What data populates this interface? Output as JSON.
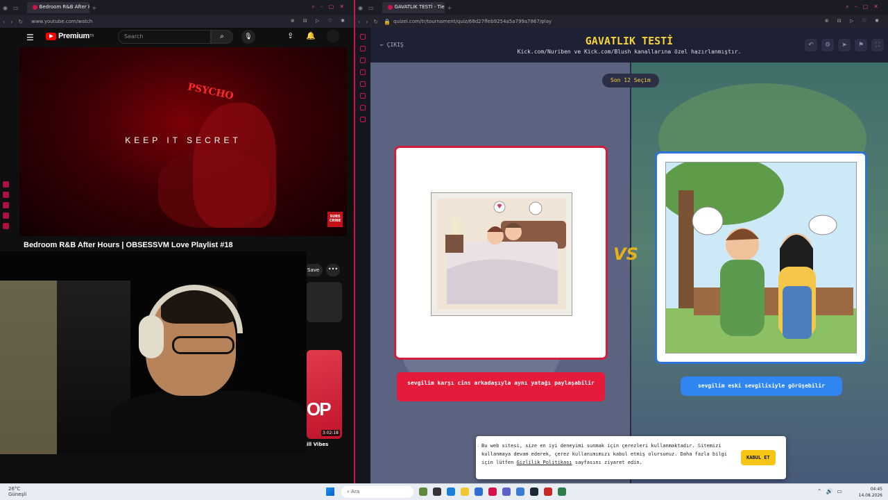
{
  "left_browser": {
    "tab_title": "Bedroom R&B After Hou",
    "url": "www.youtube.com/watch",
    "youtube": {
      "brand": "Premium",
      "region": "TR",
      "search_placeholder": "Search",
      "video_text_keep": "KEEP IT SECRET",
      "video_text_psycho": "PSYCHO",
      "subscribe_badge": "SUBS CRIBE",
      "video_title": "Bedroom R&B After Hours | OBSESSVM Love Playlist #18",
      "save_label": "Save",
      "more_label": "•••",
      "related_thumb_text": "OP",
      "related_duration": "3:02:18",
      "related_title": "ill Vibes"
    }
  },
  "right_browser": {
    "tab_title": "GAVATLIK TESTİ - Tier List",
    "url": "quizei.com/tr/tournament/quiz/68d27ffeb9254a5a799a7867/play",
    "header": {
      "back_label": "ÇIKIŞ",
      "title": "GAVATLIK TESTİ",
      "subtitle": "Kick.com/Nuriben ve Kick.com/Blush kanallarına özel hazırlanmıştır."
    },
    "round_badge": "Son 12 Seçim",
    "vs_label": "VS",
    "option_left": "sevgilim karşı cins arkadaşıyla aynı yatağı paylaşabilir",
    "option_right": "sevgilim eski sevgilisiyle görüşebilir",
    "cookie": {
      "text_1": "Bu web sitesi, size en iyi deneyimi sunmak için çerezleri kullanmaktadır. Sitemizi kullanmaya devam ederek, çerez kullanımımızı kabul etmiş olursunuz. Daha fazla bilgi için lütfen ",
      "link": "Gizlilik Politikası",
      "text_2": " sayfasını ziyaret edin.",
      "accept_label": "KABUL ET"
    }
  },
  "taskbar": {
    "temperature": "26°C",
    "weather": "Güneşli",
    "search_label": "Ara",
    "time": "04:45",
    "date": "14.08.2026"
  },
  "colors": {
    "accent": "#d4124c",
    "title_yellow": "#f5d33a",
    "left_card": "#d41c3c",
    "right_card": "#2a73d9"
  }
}
